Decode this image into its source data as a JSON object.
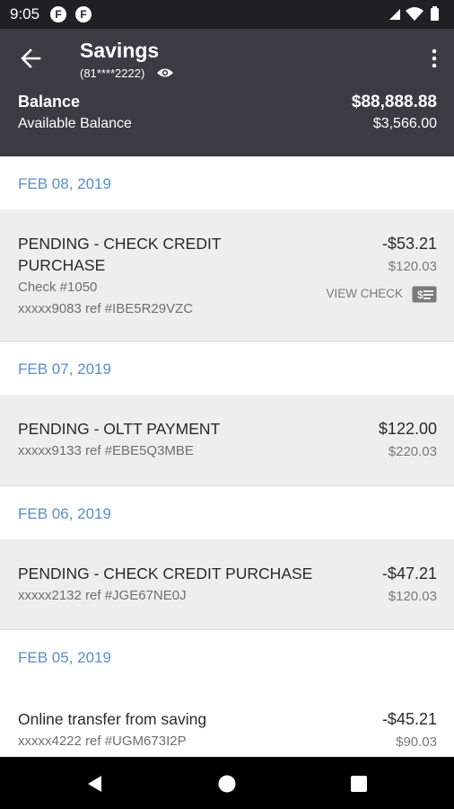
{
  "status_bar": {
    "time": "9:05",
    "app_icon_1": "F",
    "app_icon_2": "F"
  },
  "header": {
    "title": "Savings",
    "account_number": "(81****2222)",
    "balance_label": "Balance",
    "balance_value": "$88,888.88",
    "available_label": "Available Balance",
    "available_value": "$3,566.00"
  },
  "groups": [
    {
      "date": "FEB 08, 2019",
      "transactions": [
        {
          "desc": "PENDING - CHECK CREDIT PURCHASE",
          "check": "Check #1050",
          "ref": "xxxxx9083 ref #IBE5R29VZC",
          "amount": "-$53.21",
          "balance": "$120.03",
          "view_check": "VIEW CHECK"
        }
      ]
    },
    {
      "date": "FEB 07, 2019",
      "transactions": [
        {
          "desc": "PENDING - OLTT PAYMENT",
          "ref": "xxxxx9133 ref #EBE5Q3MBE",
          "amount": "$122.00",
          "balance": "$220.03"
        }
      ]
    },
    {
      "date": "FEB 06, 2019",
      "transactions": [
        {
          "desc": "PENDING - CHECK CREDIT PURCHASE",
          "ref": "xxxxx2132 ref #JGE67NE0J",
          "amount": "-$47.21",
          "balance": "$120.03"
        }
      ]
    },
    {
      "date": "FEB 05, 2019",
      "transactions": [
        {
          "desc": "Online transfer from saving",
          "ref": "xxxxx4222 ref #UGM673I2P",
          "amount": "-$45.21",
          "balance": "$90.03"
        }
      ]
    }
  ],
  "icons": {
    "back": "arrow-left-icon",
    "more": "more-vert-icon",
    "eye": "eye-icon",
    "check": "check-icon",
    "wifi": "wifi-icon",
    "signal": "signal-icon",
    "battery": "battery-icon",
    "nav_back": "nav-back-icon",
    "nav_home": "nav-home-icon",
    "nav_recents": "nav-recents-icon"
  },
  "colors": {
    "header_bg": "#393c42",
    "status_bg": "#1f2023",
    "date_blue": "#5b8ec9",
    "row_gray": "#eeeeee"
  }
}
